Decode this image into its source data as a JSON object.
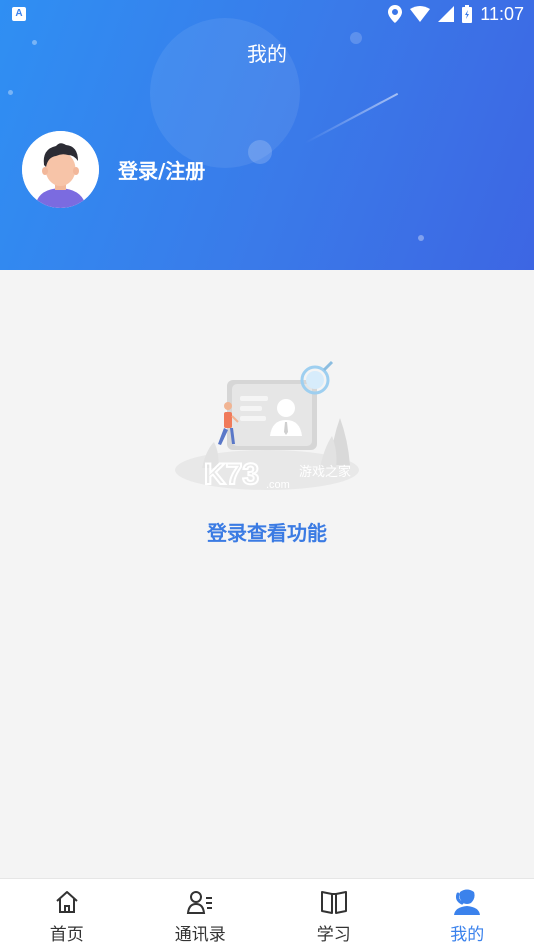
{
  "status_bar": {
    "time": "11:07"
  },
  "header": {
    "title": "我的",
    "login_text": "登录/注册"
  },
  "empty_state": {
    "watermark_main": "K73",
    "watermark_sub": "游戏之家",
    "watermark_domain": ".com",
    "action_text": "登录查看功能"
  },
  "tabbar": {
    "active_color": "#3b82ec",
    "tabs": [
      {
        "label": "首页",
        "icon": "home-icon"
      },
      {
        "label": "通讯录",
        "icon": "contacts-icon"
      },
      {
        "label": "学习",
        "icon": "book-icon"
      },
      {
        "label": "我的",
        "icon": "profile-icon",
        "active": true
      }
    ]
  }
}
